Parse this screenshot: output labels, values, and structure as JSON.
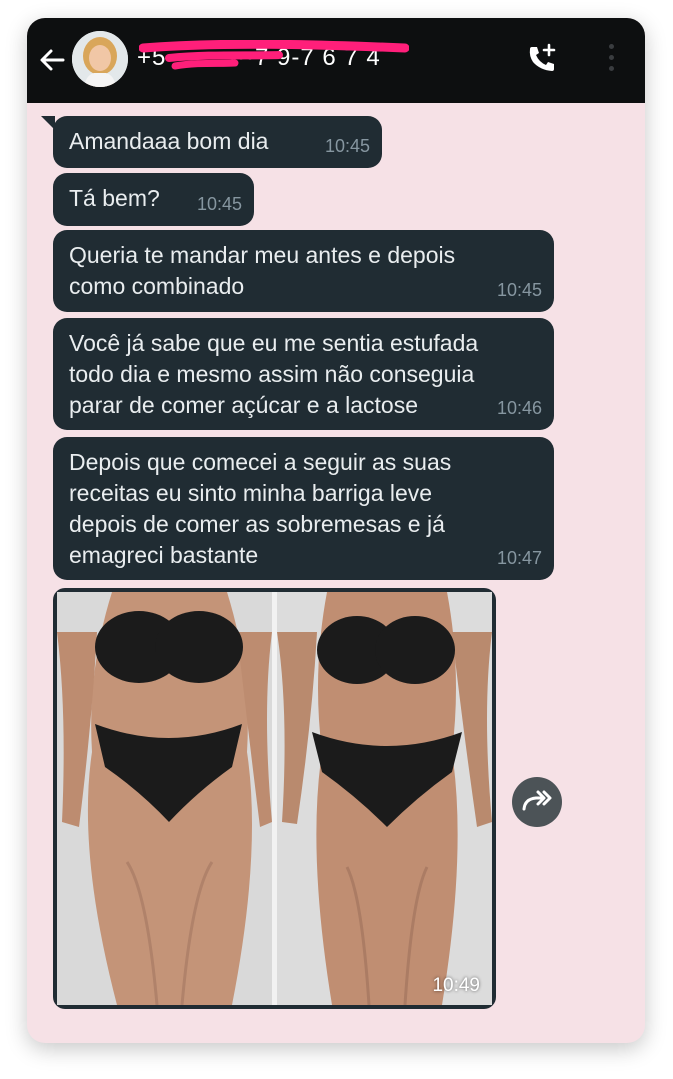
{
  "header": {
    "contact": "+5 ·········7 9-7 6 7 4",
    "back_icon": "arrow-left-icon",
    "call_icon": "add-call-icon",
    "menu_icon": "more-vertical-icon"
  },
  "messages": [
    {
      "text": "Amandaaa bom dia",
      "time": "10:45"
    },
    {
      "text": "Tá bem?",
      "time": "10:45"
    },
    {
      "text": "Queria te mandar meu antes e depois\ncomo combinado",
      "time": "10:45"
    },
    {
      "text": "Você já sabe que eu me sentia estufada\ntodo dia e mesmo assim não conseguia\nparar de comer açúcar e a lactose",
      "time": "10:46"
    },
    {
      "text": "Depois que comecei a seguir as suas\nreceitas eu sinto minha barriga leve\ndepois de comer as sobremesas e já\nemagreci bastante",
      "time": "10:47"
    }
  ],
  "photo_message": {
    "time": "10:49"
  },
  "forward_icon": "forward-icon",
  "colors": {
    "chat_background": "#f6e1e6",
    "header": "#0d0f10",
    "bubble": "#202c33",
    "redaction": "#ff1f7a"
  }
}
